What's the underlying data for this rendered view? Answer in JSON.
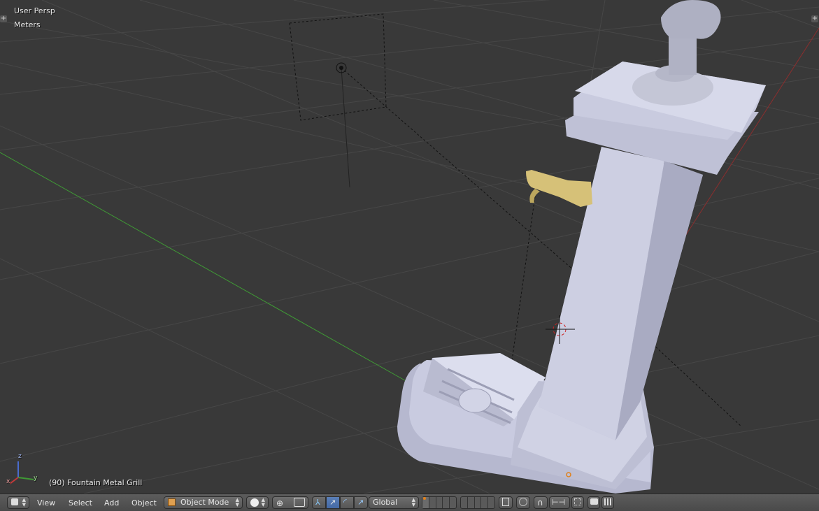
{
  "viewport": {
    "view_name": "User Persp",
    "units": "Meters",
    "object_info": "(90) Fountain Metal Grill",
    "axis_labels": {
      "x": "x",
      "y": "y",
      "z": "z"
    }
  },
  "header": {
    "menus": {
      "view": "View",
      "select": "Select",
      "add": "Add",
      "object": "Object"
    },
    "mode": "Object Mode",
    "orientation": "Global"
  },
  "colors": {
    "viewport_bg": "#393939",
    "grid": "#474747",
    "x_axis": "#8b2e2e",
    "y_axis": "#3f9a35",
    "model": "#c4c6dc",
    "brass": "#d6c178",
    "header_active": "#5678b0"
  },
  "icons": [
    "editor-type-icon",
    "object-mode-cube-icon",
    "viewport-shading-icon",
    "pivot-point-icon",
    "manipulator-icon",
    "translate-icon",
    "rotate-icon",
    "scale-icon",
    "layers-icon",
    "lock-layers-icon",
    "proportional-edit-icon",
    "snap-magnet-icon",
    "snap-element-icon",
    "render-icon",
    "render-animation-icon"
  ]
}
